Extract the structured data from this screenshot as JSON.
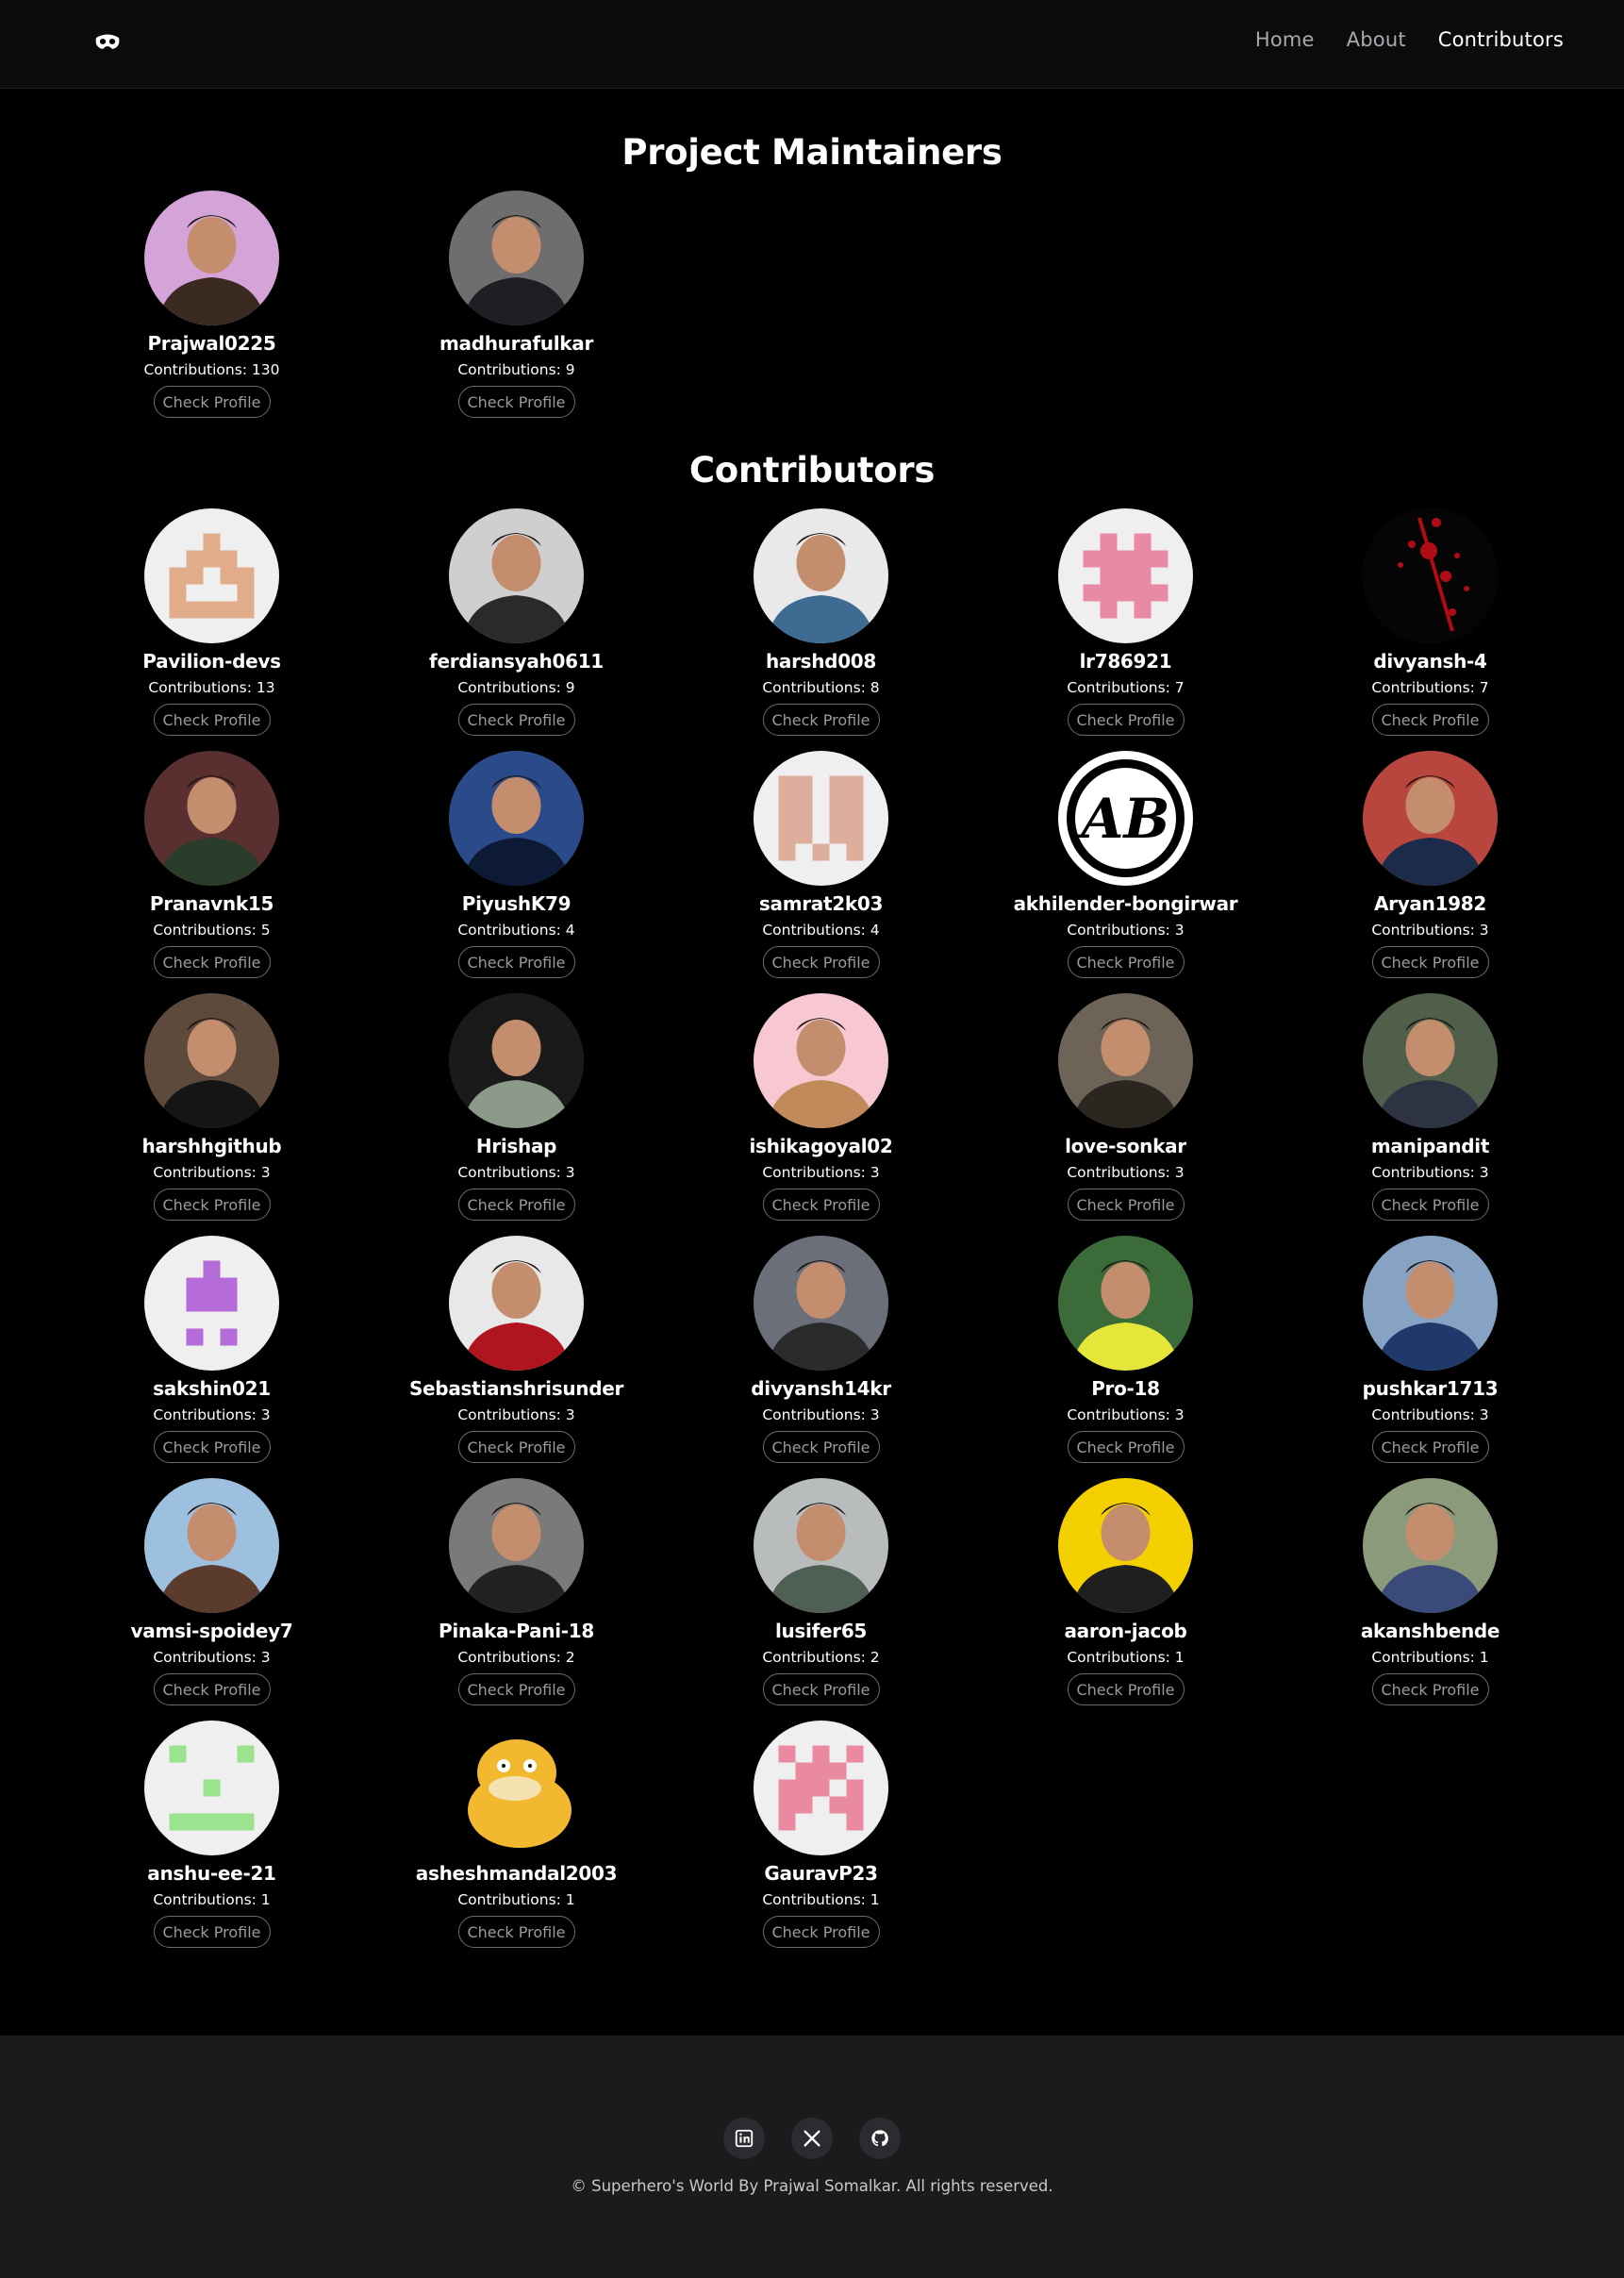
{
  "nav": {
    "logo_icon": "mask-icon",
    "links": [
      {
        "label": "Home",
        "active": false
      },
      {
        "label": "About",
        "active": false
      },
      {
        "label": "Contributors",
        "active": true
      }
    ]
  },
  "maintainers": {
    "title": "Project Maintainers",
    "button_label": "Check Profile",
    "people": [
      {
        "name": "Prajwal0225",
        "contributions": "Contributions: 130",
        "avatar": "photo",
        "bg": "#d4a3d8",
        "fg": "#3b2a22"
      },
      {
        "name": "madhurafulkar",
        "contributions": "Contributions: 9",
        "avatar": "photo",
        "bg": "#6e6e6e",
        "fg": "#1e1e24"
      }
    ]
  },
  "contributors": {
    "title": "Contributors",
    "button_label": "Check Profile",
    "people": [
      {
        "name": "Pavilion-devs",
        "contributions": "Contributions: 13",
        "avatar": "identicon",
        "bg": "#efefef",
        "fg": "#e0ac8a",
        "pattern": "0010001110110111000111111"
      },
      {
        "name": "ferdiansyah0611",
        "contributions": "Contributions: 9",
        "avatar": "photo",
        "bg": "#cfcfcf",
        "fg": "#2a2a2a"
      },
      {
        "name": "harshd008",
        "contributions": "Contributions: 8",
        "avatar": "photo",
        "bg": "#e9e9e9",
        "fg": "#3d6b91"
      },
      {
        "name": "lr786921",
        "contributions": "Contributions: 7",
        "avatar": "identicon",
        "bg": "#efefef",
        "fg": "#e88aa6",
        "pattern": "0101011111011101111101010"
      },
      {
        "name": "divyansh-4",
        "contributions": "Contributions: 7",
        "avatar": "splatter",
        "bg": "#050505",
        "fg": "#b00c14"
      },
      {
        "name": "Pranavnk15",
        "contributions": "Contributions: 5",
        "avatar": "photo",
        "bg": "#5a2f2f",
        "fg": "#2a3d2a"
      },
      {
        "name": "PiyushK79",
        "contributions": "Contributions: 4",
        "avatar": "photo",
        "bg": "#2b4a8a",
        "fg": "#0d1a35"
      },
      {
        "name": "samrat2k03",
        "contributions": "Contributions: 4",
        "avatar": "identicon",
        "bg": "#efefef",
        "fg": "#dcae9b",
        "pattern": "1101111011110111101110101"
      },
      {
        "name": "akhilender-bongirwar",
        "contributions": "Contributions: 3",
        "avatar": "monogram",
        "bg": "#ffffff",
        "fg": "#000000",
        "text": "AB"
      },
      {
        "name": "Aryan1982",
        "contributions": "Contributions: 3",
        "avatar": "photo",
        "bg": "#b8463f",
        "fg": "#1d2b4a"
      },
      {
        "name": "harshhgithub",
        "contributions": "Contributions: 3",
        "avatar": "photo",
        "bg": "#5e4a3c",
        "fg": "#151515"
      },
      {
        "name": "Hrishap",
        "contributions": "Contributions: 3",
        "avatar": "photo",
        "bg": "#1a1a1a",
        "fg": "#8c9a8a"
      },
      {
        "name": "ishikagoyal02",
        "contributions": "Contributions: 3",
        "avatar": "photo",
        "bg": "#f7c8d2",
        "fg": "#c08a5a"
      },
      {
        "name": "love-sonkar",
        "contributions": "Contributions: 3",
        "avatar": "photo",
        "bg": "#6d6357",
        "fg": "#2c2620"
      },
      {
        "name": "manipandit",
        "contributions": "Contributions: 3",
        "avatar": "photo",
        "bg": "#4f5f4a",
        "fg": "#2e3344"
      },
      {
        "name": "sakshin021",
        "contributions": "Contributions: 3",
        "avatar": "identicon",
        "bg": "#efefef",
        "fg": "#b56bd8",
        "pattern": "0010001110011100000001010"
      },
      {
        "name": "Sebastianshrisunder",
        "contributions": "Contributions: 3",
        "avatar": "photo",
        "bg": "#e8e8e8",
        "fg": "#b0141e"
      },
      {
        "name": "divyansh14kr",
        "contributions": "Contributions: 3",
        "avatar": "photo",
        "bg": "#6a6f79",
        "fg": "#2b2b2b"
      },
      {
        "name": "Pro-18",
        "contributions": "Contributions: 3",
        "avatar": "photo",
        "bg": "#3c6b3a",
        "fg": "#e6e63a"
      },
      {
        "name": "pushkar1713",
        "contributions": "Contributions: 3",
        "avatar": "photo",
        "bg": "#87a3c4",
        "fg": "#1f3a6a"
      },
      {
        "name": "vamsi-spoidey7",
        "contributions": "Contributions: 3",
        "avatar": "photo",
        "bg": "#9ec0df",
        "fg": "#5a3b2c"
      },
      {
        "name": "Pinaka-Pani-18",
        "contributions": "Contributions: 2",
        "avatar": "photo",
        "bg": "#7a7a7a",
        "fg": "#222222"
      },
      {
        "name": "lusifer65",
        "contributions": "Contributions: 2",
        "avatar": "photo",
        "bg": "#b8bcbd",
        "fg": "#4f5f53"
      },
      {
        "name": "aaron-jacob",
        "contributions": "Contributions: 1",
        "avatar": "photo",
        "bg": "#f5d000",
        "fg": "#1f1f1f"
      },
      {
        "name": "akanshbende",
        "contributions": "Contributions: 1",
        "avatar": "photo",
        "bg": "#8a9a7a",
        "fg": "#3a4a7a"
      },
      {
        "name": "anshu-ee-21",
        "contributions": "Contributions: 1",
        "avatar": "identicon",
        "bg": "#efefef",
        "fg": "#9be38f",
        "pattern": "1000100000001000000011111"
      },
      {
        "name": "asheshmandal2003",
        "contributions": "Contributions: 1",
        "avatar": "duck",
        "bg": "#000000",
        "fg": "#f2b830"
      },
      {
        "name": "GauravP23",
        "contributions": "Contributions: 1",
        "avatar": "identicon",
        "bg": "#efefef",
        "fg": "#ea8aa0",
        "pattern": "1010101110111011101110001"
      }
    ]
  },
  "footer": {
    "socials": [
      {
        "icon": "linkedin-icon",
        "label": "LinkedIn"
      },
      {
        "icon": "x-icon",
        "label": "X"
      },
      {
        "icon": "github-icon",
        "label": "GitHub"
      }
    ],
    "copyright": "© Superhero's World By Prajwal Somalkar. All rights reserved."
  }
}
